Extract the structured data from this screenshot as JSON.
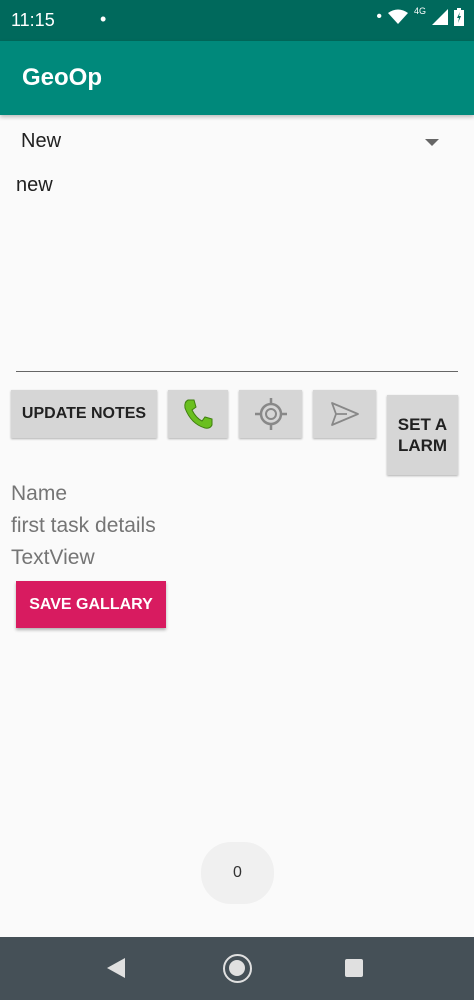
{
  "status_bar": {
    "time": "11:15",
    "network": "4G"
  },
  "app_bar": {
    "title": "GeoOp"
  },
  "spinner": {
    "selected": "New"
  },
  "notes": {
    "value": "new"
  },
  "actions": {
    "update_notes_label": "UPDATE NOTES",
    "call_icon": "phone-icon",
    "locate_icon": "gps-target-icon",
    "send_icon": "send-icon",
    "set_alarm_label": "SET ALARM"
  },
  "info": {
    "name": "Name",
    "details": "first task details",
    "textview": "TextView"
  },
  "save_gallery_label": "SAVE GALLARY",
  "counter": "0",
  "colors": {
    "status_bar": "#00695c",
    "app_bar": "#00897b",
    "accent": "#d81b60",
    "call_green": "#6abf1f"
  }
}
